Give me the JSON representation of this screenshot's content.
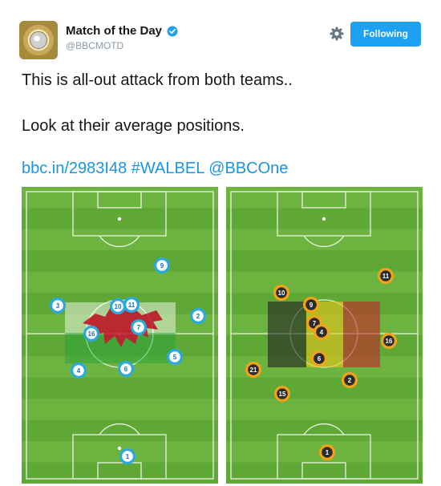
{
  "account": {
    "name": "Match of the Day",
    "handle": "@BBCMOTD",
    "verified": true,
    "avatar": "match-of-the-day-logo"
  },
  "actions": {
    "settings_icon": "gear-icon",
    "follow_label": "Following"
  },
  "tweet": {
    "line1": "This is all-out attack from both teams..",
    "line2": "Look at their average positions.",
    "link": "bbc.in/2983I48",
    "hashtag": "#WALBEL",
    "mention": "@BBCOne"
  },
  "colors": {
    "accent": "#1da1f2",
    "pitch_light": "#6db33f",
    "pitch_dark": "#5fa835",
    "wales_marker": "#29a9e0",
    "belgium_marker": "#f2a31a"
  },
  "pitches": {
    "left": {
      "team": "Wales",
      "players": [
        "9",
        "3",
        "10",
        "11",
        "2",
        "7",
        "16",
        "5",
        "6",
        "4",
        "1"
      ]
    },
    "right": {
      "team": "Belgium",
      "players": [
        "11",
        "10",
        "9",
        "7",
        "4",
        "16",
        "6",
        "21",
        "2",
        "15",
        "1"
      ]
    }
  }
}
